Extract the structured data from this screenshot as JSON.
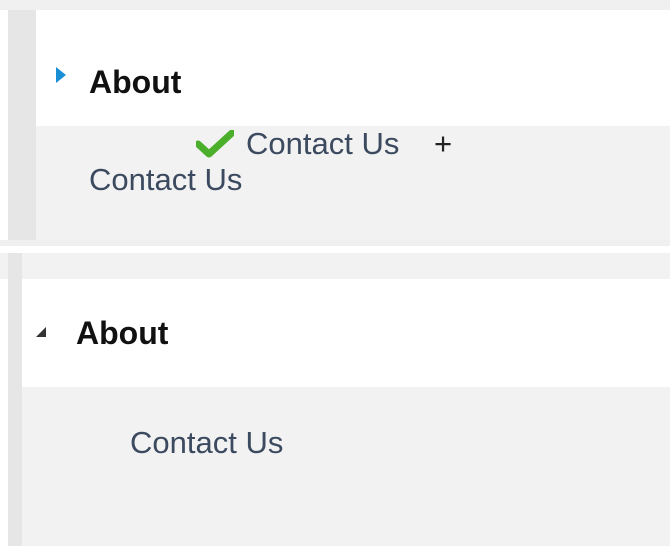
{
  "top_panel": {
    "section_title": "About",
    "drag_preview": {
      "label": "Contact Us",
      "plus_symbol": "+"
    },
    "item_label": "Contact Us",
    "expander_icon": "triangle-right-icon",
    "drop_icon": "checkmark-icon"
  },
  "bottom_panel": {
    "section_title": "About",
    "item_label": "Contact Us",
    "expander_icon": "triangle-down-icon"
  },
  "colors": {
    "expander_collapsed": "#1a8fd6",
    "checkmark": "#4caf2c",
    "item_text": "#3c4a60"
  }
}
